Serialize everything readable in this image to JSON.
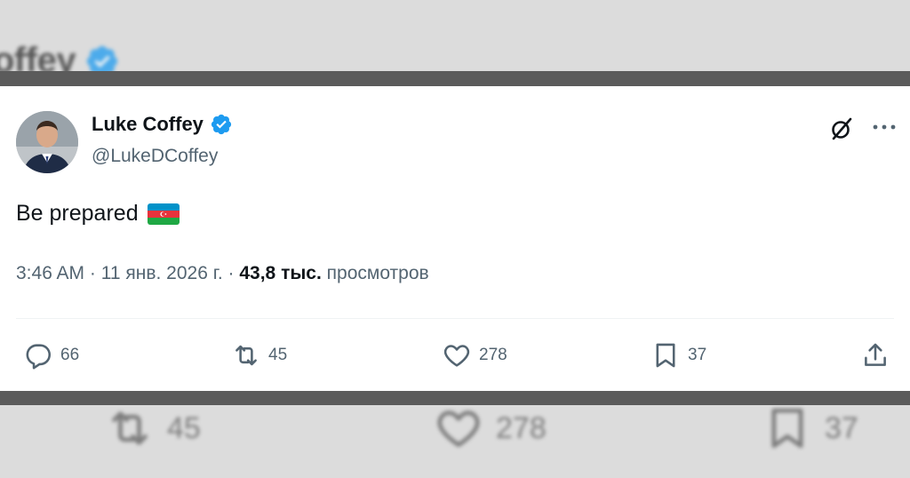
{
  "background": {
    "top_name_fragment": "offey",
    "retweets": "45",
    "likes": "278",
    "bookmarks": "37"
  },
  "tweet": {
    "author_name": "Luke Coffey",
    "author_handle": "@LukeDCoffey",
    "verified": true,
    "text": "Be prepared",
    "flag": "azerbaijan-flag",
    "time": "3:46 AM",
    "separator": "·",
    "date": "11 янв. 2026 г.",
    "views_count": "43,8 тыс.",
    "views_label": "просмотров",
    "actions": {
      "replies": "66",
      "retweets": "45",
      "likes": "278",
      "bookmarks": "37"
    }
  },
  "colors": {
    "verified_blue": "#1d9bf0",
    "text_primary": "#0f1419",
    "text_secondary": "#536471",
    "flag_blue": "#0092c9",
    "flag_red": "#e8323c",
    "flag_green": "#1fa844"
  },
  "icons": [
    "verified-badge-icon",
    "grok-icon",
    "more-icon",
    "reply-icon",
    "retweet-icon",
    "like-icon",
    "bookmark-icon",
    "share-icon"
  ]
}
